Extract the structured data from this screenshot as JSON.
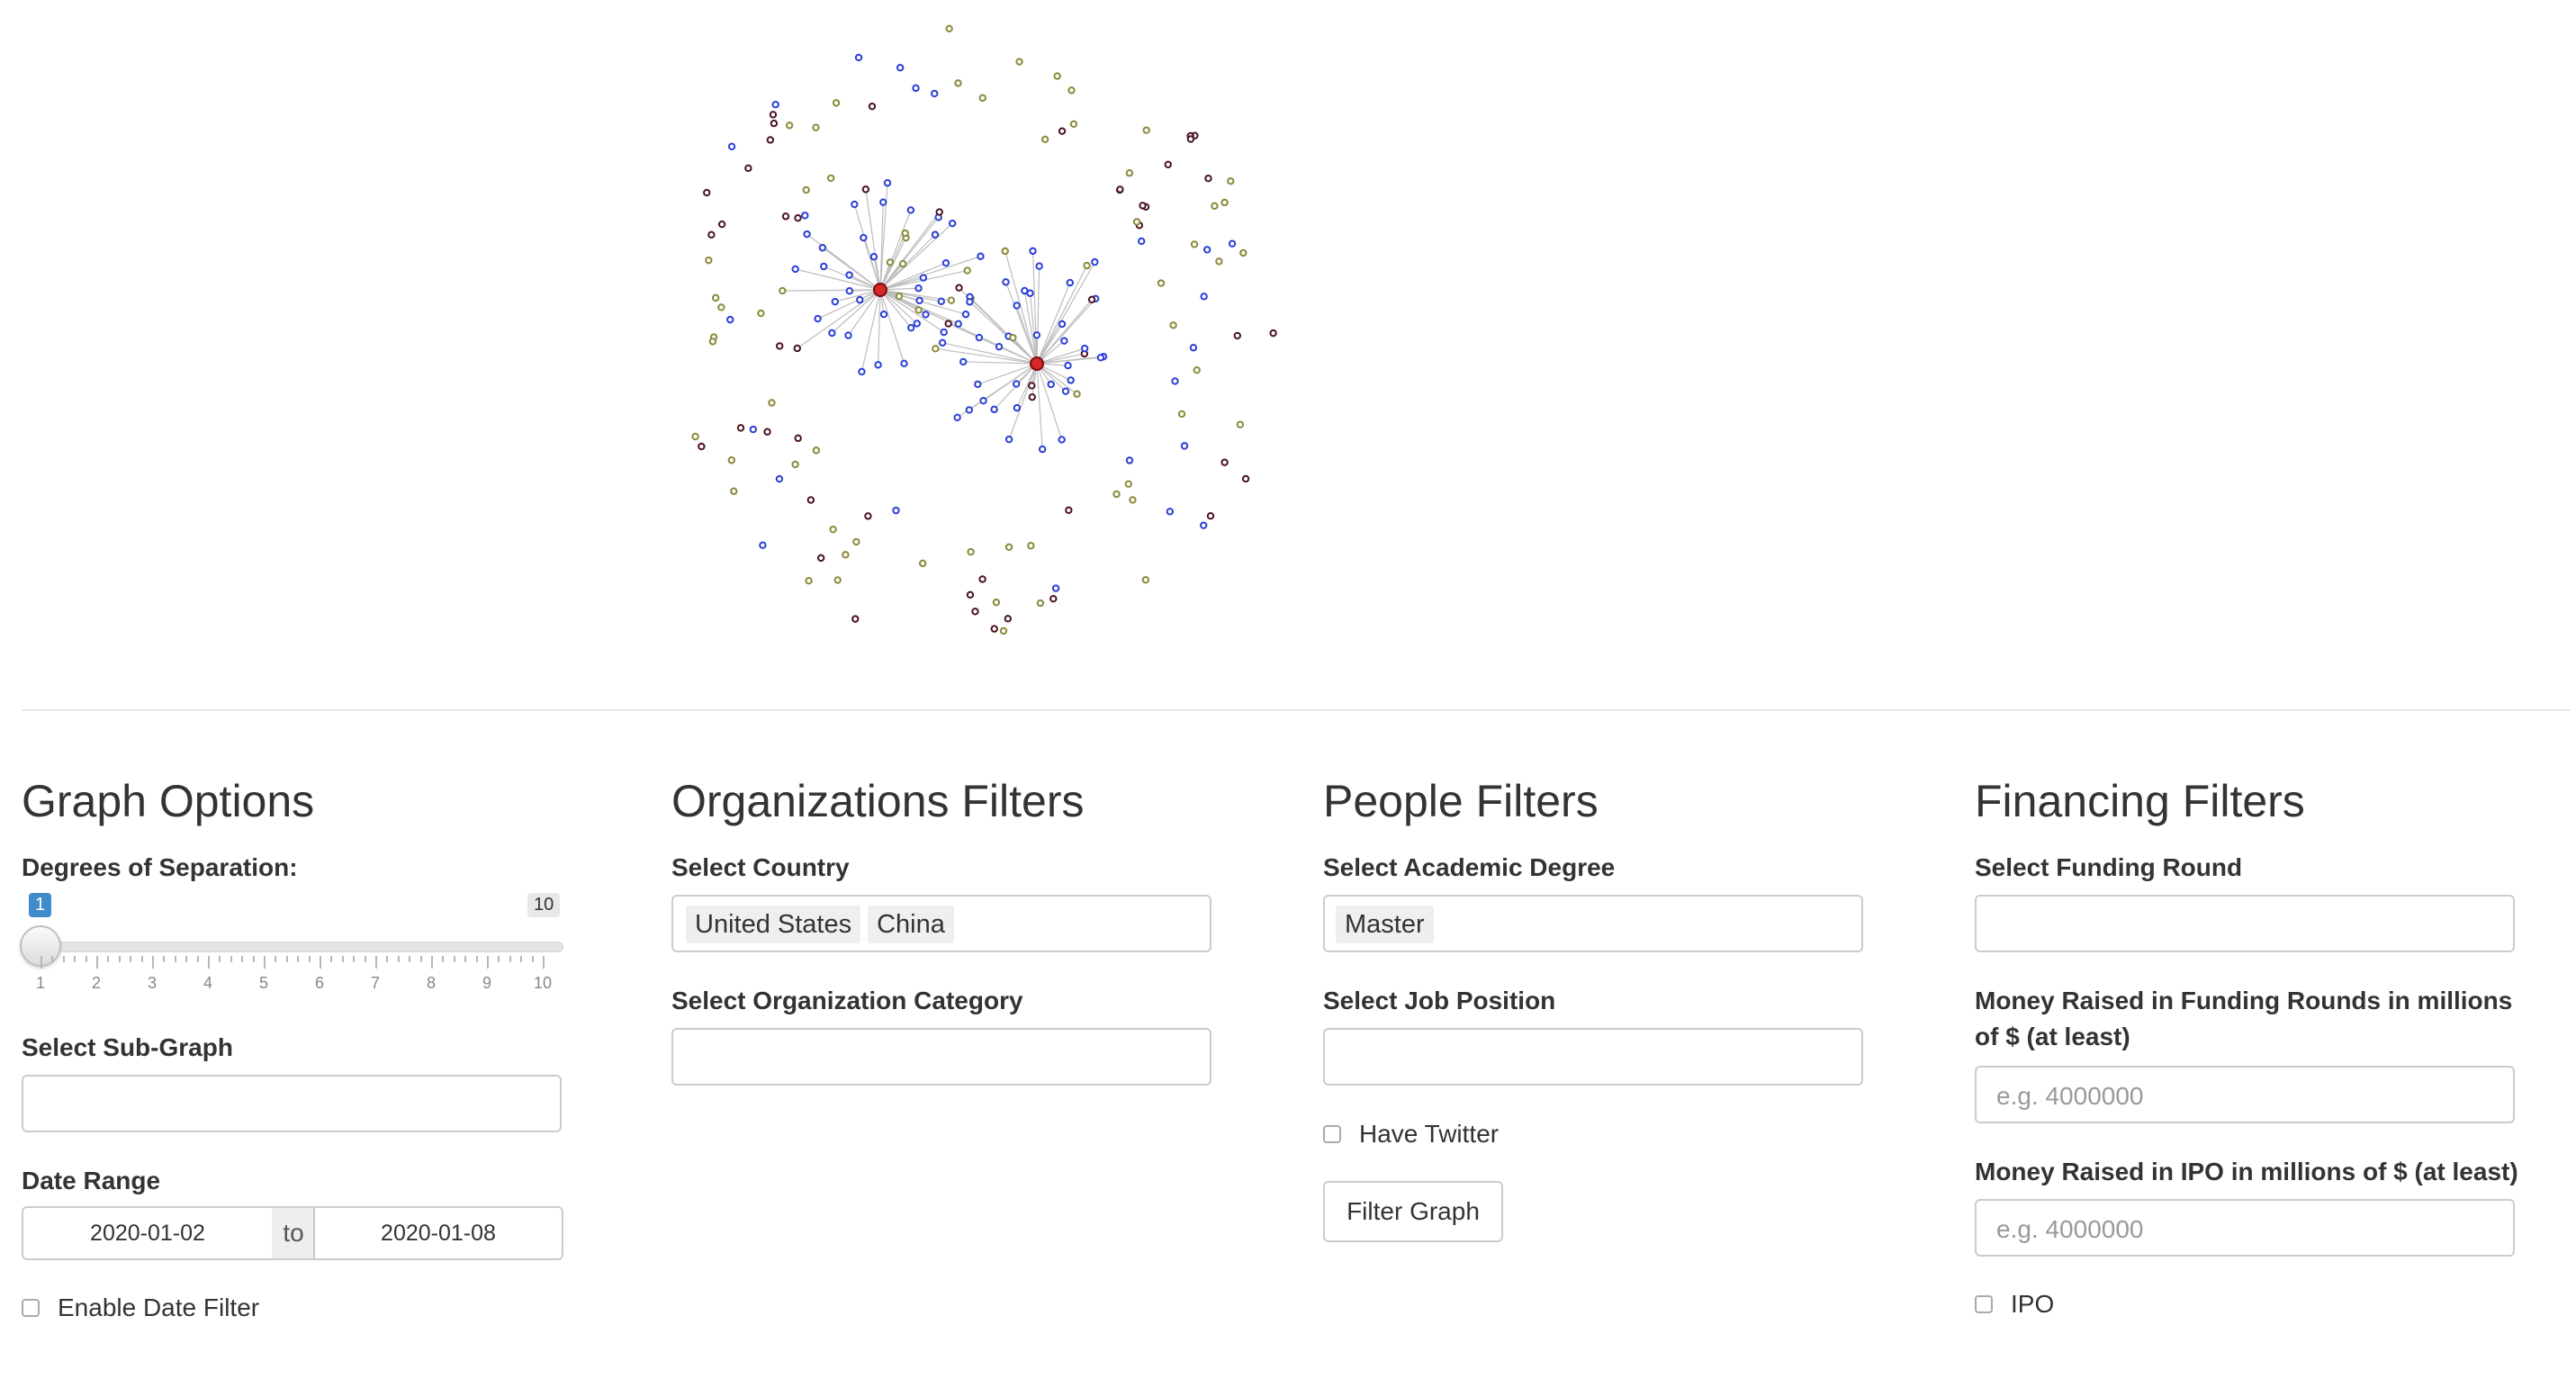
{
  "graph": {
    "colors": {
      "hub": "#d62728",
      "blue": "#2a3fd6",
      "dark": "#4a1320",
      "olive": "#8a8a3a",
      "edge": "#bdbdbd"
    }
  },
  "graph_options": {
    "title": "Graph Options",
    "degrees_label": "Degrees of Separation:",
    "slider": {
      "min": 1,
      "max": 10,
      "value": 1,
      "ticks": [
        "1",
        "2",
        "3",
        "4",
        "5",
        "6",
        "7",
        "8",
        "9",
        "10"
      ]
    },
    "subgraph_label": "Select Sub-Graph",
    "date_range_label": "Date Range",
    "date_from": "2020-01-02",
    "date_sep": "to",
    "date_to": "2020-01-08",
    "enable_date_filter": "Enable Date Filter"
  },
  "org_filters": {
    "title": "Organizations Filters",
    "country_label": "Select Country",
    "countries": [
      "United States",
      "China"
    ],
    "category_label": "Select Organization Category"
  },
  "people_filters": {
    "title": "People Filters",
    "degree_label": "Select Academic Degree",
    "degrees": [
      "Master"
    ],
    "job_label": "Select Job Position",
    "twitter_label": "Have Twitter",
    "filter_button": "Filter Graph"
  },
  "financing_filters": {
    "title": "Financing Filters",
    "round_label": "Select Funding Round",
    "money_rounds_label_1": "Money Raised in Funding Rounds in millions",
    "money_rounds_label_2": "of $ (at least)",
    "money_rounds_placeholder": "e.g. 4000000",
    "ipo_money_label": "Money Raised in IPO in millions of $ (at least)",
    "ipo_money_placeholder": "e.g. 4000000",
    "ipo_label": "IPO"
  }
}
